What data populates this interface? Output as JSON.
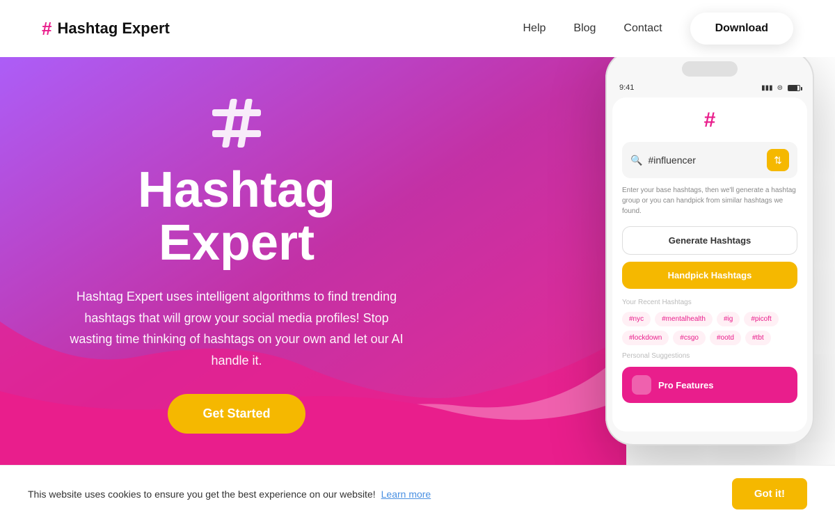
{
  "navbar": {
    "logo_hash": "#",
    "logo_text": "Hashtag Expert",
    "links": [
      {
        "label": "Help",
        "id": "help"
      },
      {
        "label": "Blog",
        "id": "blog"
      },
      {
        "label": "Contact",
        "id": "contact"
      }
    ],
    "download_label": "Download"
  },
  "hero": {
    "hash_icon": "#",
    "title": "Hashtag Expert",
    "description": "Hashtag Expert uses intelligent algorithms to find trending hashtags that will grow your social media profiles! Stop wasting time thinking of hashtags on your own and let our AI handle it.",
    "cta_label": "Get Started"
  },
  "phone": {
    "status_time": "9:41",
    "app_hash": "#",
    "search_placeholder": "#influencer",
    "hint": "Enter your base hashtags, then we'll generate a hashtag group or you can handpick from similar hashtags we found.",
    "btn_generate": "Generate Hashtags",
    "btn_handpick": "Handpick Hashtags",
    "recent_label": "Your Recent Hashtags",
    "recent_tags": [
      "#nyc",
      "#mentalhealth",
      "#ig",
      "#picoft",
      "#lockdown",
      "#csgo",
      "#ootd",
      "#tbt"
    ],
    "personal_label": "Personal Suggestions",
    "pro_label": "Pro Features"
  },
  "cookie": {
    "message": "This website uses cookies to ensure you get the best experience on our website!",
    "link_text": "Learn more",
    "btn_label": "Got it!"
  },
  "colors": {
    "pink": "#e91e8c",
    "yellow": "#f5b800",
    "purple": "#9c4dcc"
  }
}
